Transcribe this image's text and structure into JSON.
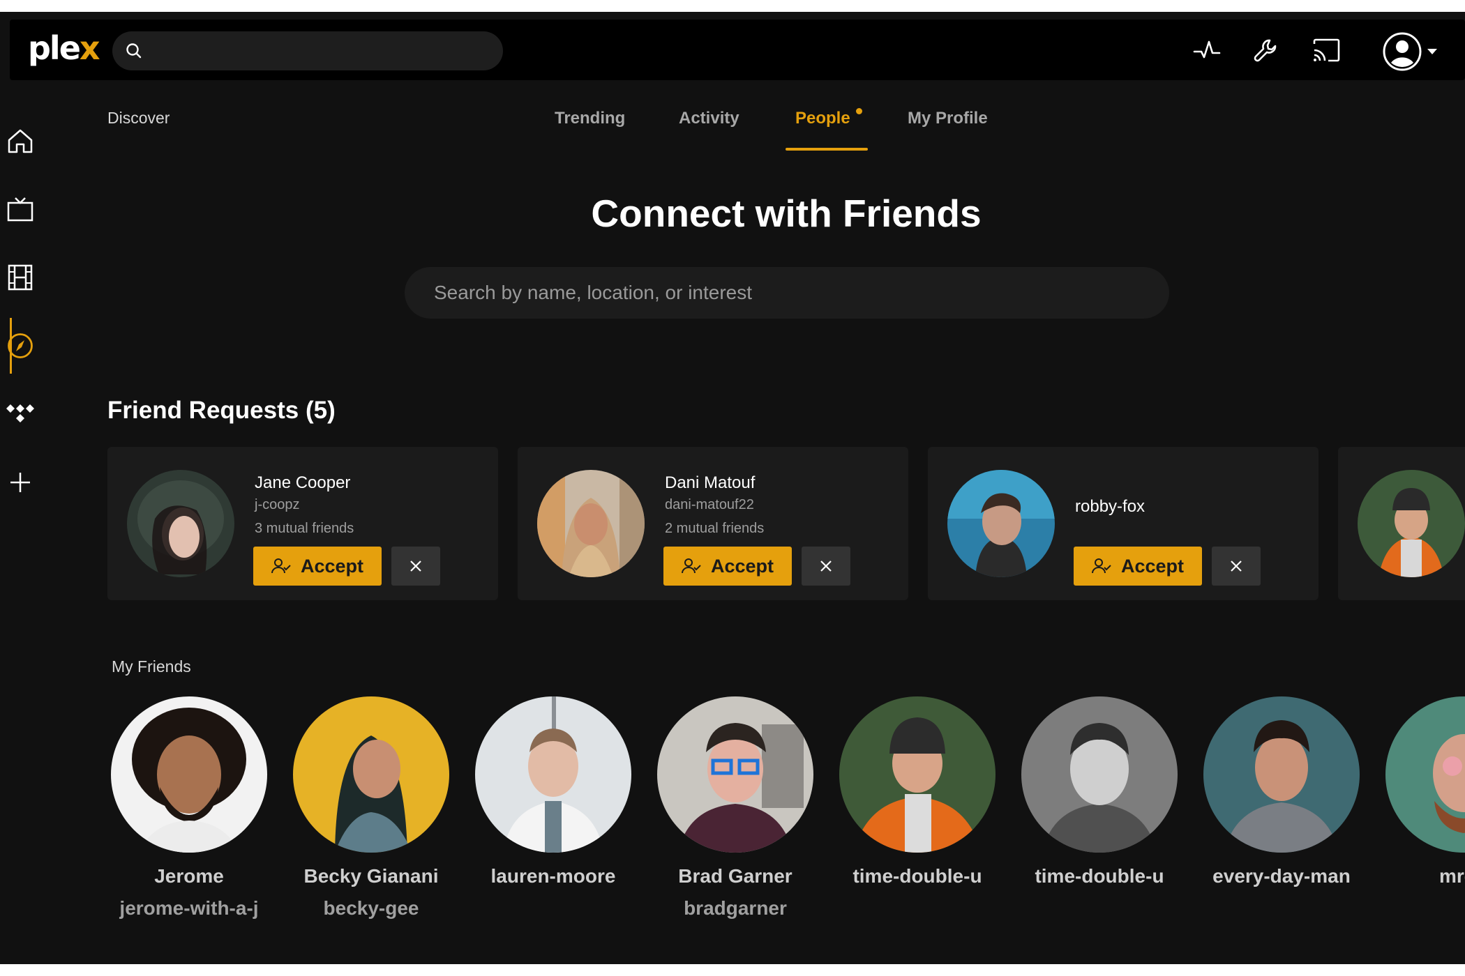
{
  "app": {
    "logo_main": "ple",
    "logo_accent": "x",
    "accent_color": "#e5a00d"
  },
  "topbar": {
    "icons": [
      "activity-icon",
      "wrench-icon",
      "cast-icon",
      "user-account-icon"
    ]
  },
  "sidenav": {
    "items": [
      {
        "name": "home",
        "icon": "home-icon",
        "active": false
      },
      {
        "name": "live-tv",
        "icon": "tv-icon",
        "active": false
      },
      {
        "name": "movies",
        "icon": "film-icon",
        "active": false
      },
      {
        "name": "discover",
        "icon": "compass-icon",
        "active": true
      },
      {
        "name": "music",
        "icon": "tidal-icon",
        "active": false
      },
      {
        "name": "add",
        "icon": "plus-icon",
        "active": false
      }
    ]
  },
  "header": {
    "breadcrumb": "Discover",
    "tabs": [
      {
        "label": "Trending",
        "active": false
      },
      {
        "label": "Activity",
        "active": false
      },
      {
        "label": "People",
        "active": true,
        "notification_dot": true
      },
      {
        "label": "My Profile",
        "active": false
      }
    ]
  },
  "main": {
    "title": "Connect with Friends",
    "search_placeholder": "Search by name, location, or interest"
  },
  "requests": {
    "title": "Friend Requests (5)",
    "accept_label": "Accept",
    "items": [
      {
        "name": "Jane Cooper",
        "username": "j-coopz",
        "mutual": "3 mutual friends"
      },
      {
        "name": "Dani Matouf",
        "username": "dani-matouf22",
        "mutual": "2 mutual friends"
      },
      {
        "name": "",
        "username": "robby-fox",
        "mutual": ""
      }
    ]
  },
  "friends": {
    "title": "My Friends",
    "items": [
      {
        "name": "Jerome",
        "username": "jerome-with-a-j"
      },
      {
        "name": "Becky Gianani",
        "username": "becky-gee"
      },
      {
        "name": "lauren-moore",
        "username": ""
      },
      {
        "name": "Brad Garner",
        "username": "bradgarner"
      },
      {
        "name": "time-double-u",
        "username": ""
      },
      {
        "name": "time-double-u",
        "username": ""
      },
      {
        "name": "every-day-man",
        "username": ""
      },
      {
        "name": "mr-pi",
        "username": ""
      }
    ]
  }
}
